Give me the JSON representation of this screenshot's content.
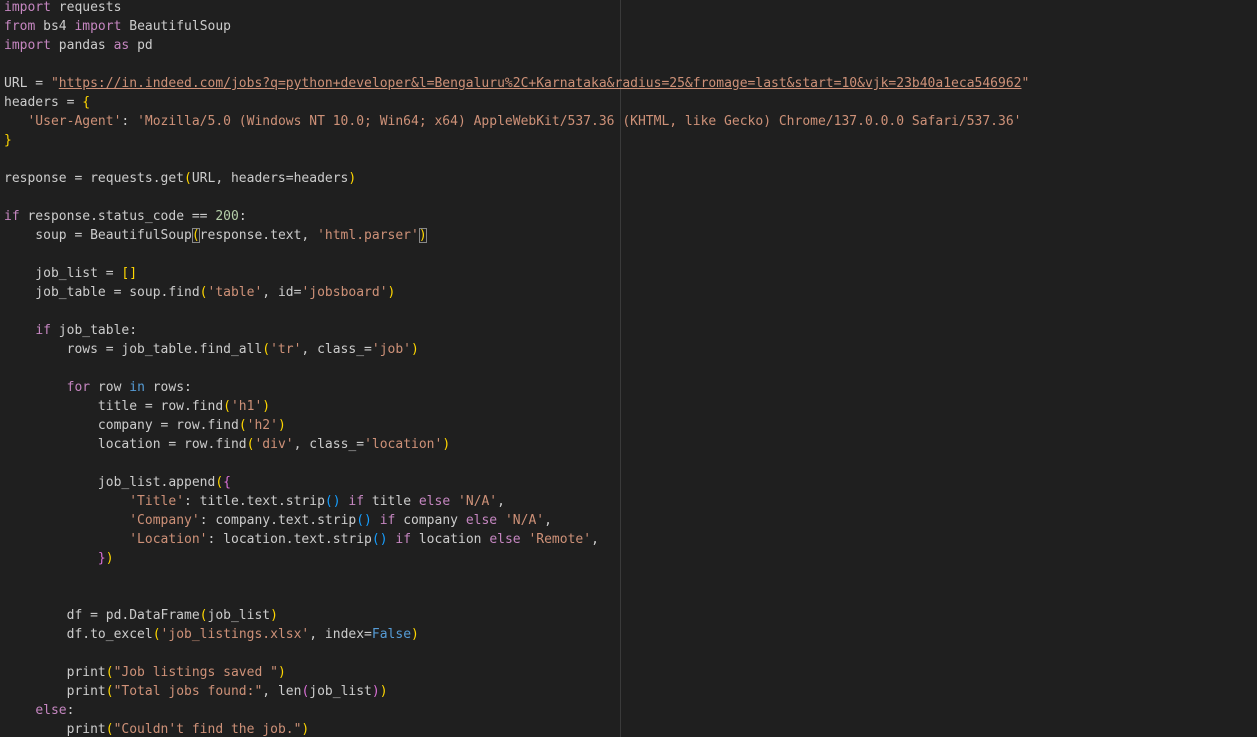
{
  "editor": {
    "language": "python",
    "colors": {
      "background": "#1f1f1f",
      "default": "#cccccc",
      "keyword_control": "#c586c0",
      "keyword_builtin": "#569cd6",
      "string": "#ce9178",
      "number": "#b5cea8",
      "bracket_1": "#ffd700",
      "bracket_2": "#da70d6",
      "bracket_3": "#179fff"
    },
    "lines": [
      [
        [
          "k",
          "import"
        ],
        [
          "p",
          " requests"
        ]
      ],
      [
        [
          "k",
          "from"
        ],
        [
          "p",
          " bs4 "
        ],
        [
          "k",
          "import"
        ],
        [
          "p",
          " BeautifulSoup"
        ]
      ],
      [
        [
          "k",
          "import"
        ],
        [
          "p",
          " pandas "
        ],
        [
          "k",
          "as"
        ],
        [
          "p",
          " pd"
        ]
      ],
      [],
      [
        [
          "p",
          "URL = "
        ],
        [
          "s",
          "\""
        ],
        [
          "u",
          "https://in.indeed.com/jobs?q=python+developer&l=Bengaluru%2C+Karnataka&radius=25&fromage=last&start=10&vjk=23b40a1eca546962"
        ],
        [
          "s",
          "\""
        ]
      ],
      [
        [
          "p",
          "headers = "
        ],
        [
          "b1",
          "{"
        ]
      ],
      [
        [
          "p",
          "   "
        ],
        [
          "s",
          "'User-Agent'"
        ],
        [
          "p",
          ": "
        ],
        [
          "s",
          "'Mozilla/5.0 (Windows NT 10.0; Win64; x64) AppleWebKit/537.36 (KHTML, like Gecko) Chrome/137.0.0.0 Safari/537.36'"
        ]
      ],
      [
        [
          "b1",
          "}"
        ]
      ],
      [],
      [
        [
          "p",
          "response = requests.get"
        ],
        [
          "b1",
          "("
        ],
        [
          "p",
          "URL, headers=headers"
        ],
        [
          "b1",
          ")"
        ]
      ],
      [],
      [
        [
          "k",
          "if"
        ],
        [
          "p",
          " response.status_code == "
        ],
        [
          "n",
          "200"
        ],
        [
          "p",
          ":"
        ]
      ],
      [
        [
          "p",
          "    soup = BeautifulSoup"
        ],
        [
          "b1m",
          "("
        ],
        [
          "p",
          "response.text, "
        ],
        [
          "s",
          "'html.parser'"
        ],
        [
          "b1m",
          ")"
        ]
      ],
      [],
      [
        [
          "p",
          "    job_list = "
        ],
        [
          "b1",
          "[]"
        ]
      ],
      [
        [
          "p",
          "    job_table = soup.find"
        ],
        [
          "b1",
          "("
        ],
        [
          "s",
          "'table'"
        ],
        [
          "p",
          ", id="
        ],
        [
          "s",
          "'jobsboard'"
        ],
        [
          "b1",
          ")"
        ]
      ],
      [],
      [
        [
          "p",
          "    "
        ],
        [
          "k",
          "if"
        ],
        [
          "p",
          " job_table:"
        ]
      ],
      [
        [
          "p",
          "        rows = job_table.find_all"
        ],
        [
          "b1",
          "("
        ],
        [
          "s",
          "'tr'"
        ],
        [
          "p",
          ", class_="
        ],
        [
          "s",
          "'job'"
        ],
        [
          "b1",
          ")"
        ]
      ],
      [],
      [
        [
          "p",
          "        "
        ],
        [
          "k",
          "for"
        ],
        [
          "p",
          " row "
        ],
        [
          "kb",
          "in"
        ],
        [
          "p",
          " rows:"
        ]
      ],
      [
        [
          "p",
          "            title = row.find"
        ],
        [
          "b1",
          "("
        ],
        [
          "s",
          "'h1'"
        ],
        [
          "b1",
          ")"
        ]
      ],
      [
        [
          "p",
          "            company = row.find"
        ],
        [
          "b1",
          "("
        ],
        [
          "s",
          "'h2'"
        ],
        [
          "b1",
          ")"
        ]
      ],
      [
        [
          "p",
          "            location = row.find"
        ],
        [
          "b1",
          "("
        ],
        [
          "s",
          "'div'"
        ],
        [
          "p",
          ", class_="
        ],
        [
          "s",
          "'location'"
        ],
        [
          "b1",
          ")"
        ]
      ],
      [],
      [
        [
          "p",
          "            job_list.append"
        ],
        [
          "b1",
          "("
        ],
        [
          "b2",
          "{"
        ]
      ],
      [
        [
          "p",
          "                "
        ],
        [
          "s",
          "'Title'"
        ],
        [
          "p",
          ": title.text.strip"
        ],
        [
          "b3",
          "()"
        ],
        [
          "p",
          " "
        ],
        [
          "k",
          "if"
        ],
        [
          "p",
          " title "
        ],
        [
          "k",
          "else"
        ],
        [
          "p",
          " "
        ],
        [
          "s",
          "'N/A'"
        ],
        [
          "p",
          ","
        ]
      ],
      [
        [
          "p",
          "                "
        ],
        [
          "s",
          "'Company'"
        ],
        [
          "p",
          ": company.text.strip"
        ],
        [
          "b3",
          "()"
        ],
        [
          "p",
          " "
        ],
        [
          "k",
          "if"
        ],
        [
          "p",
          " company "
        ],
        [
          "k",
          "else"
        ],
        [
          "p",
          " "
        ],
        [
          "s",
          "'N/A'"
        ],
        [
          "p",
          ","
        ]
      ],
      [
        [
          "p",
          "                "
        ],
        [
          "s",
          "'Location'"
        ],
        [
          "p",
          ": location.text.strip"
        ],
        [
          "b3",
          "()"
        ],
        [
          "p",
          " "
        ],
        [
          "k",
          "if"
        ],
        [
          "p",
          " location "
        ],
        [
          "k",
          "else"
        ],
        [
          "p",
          " "
        ],
        [
          "s",
          "'Remote'"
        ],
        [
          "p",
          ","
        ]
      ],
      [
        [
          "p",
          "            "
        ],
        [
          "b2",
          "}"
        ],
        [
          "b1",
          ")"
        ]
      ],
      [],
      [],
      [
        [
          "p",
          "        df = pd.DataFrame"
        ],
        [
          "b1",
          "("
        ],
        [
          "p",
          "job_list"
        ],
        [
          "b1",
          ")"
        ]
      ],
      [
        [
          "p",
          "        df.to_excel"
        ],
        [
          "b1",
          "("
        ],
        [
          "s",
          "'job_listings.xlsx'"
        ],
        [
          "p",
          ", index="
        ],
        [
          "kb",
          "False"
        ],
        [
          "b1",
          ")"
        ]
      ],
      [],
      [
        [
          "p",
          "        print"
        ],
        [
          "b1",
          "("
        ],
        [
          "s",
          "\"Job listings saved \""
        ],
        [
          "b1",
          ")"
        ]
      ],
      [
        [
          "p",
          "        print"
        ],
        [
          "b1",
          "("
        ],
        [
          "s",
          "\"Total jobs found:\""
        ],
        [
          "p",
          ", len"
        ],
        [
          "b2",
          "("
        ],
        [
          "p",
          "job_list"
        ],
        [
          "b2",
          ")"
        ],
        [
          "b1",
          ")"
        ]
      ],
      [
        [
          "p",
          "    "
        ],
        [
          "k",
          "else"
        ],
        [
          "p",
          ":"
        ]
      ],
      [
        [
          "p",
          "        print"
        ],
        [
          "b1",
          "("
        ],
        [
          "s",
          "\"Couldn't find the job.\""
        ],
        [
          "b1",
          ")"
        ]
      ]
    ]
  }
}
